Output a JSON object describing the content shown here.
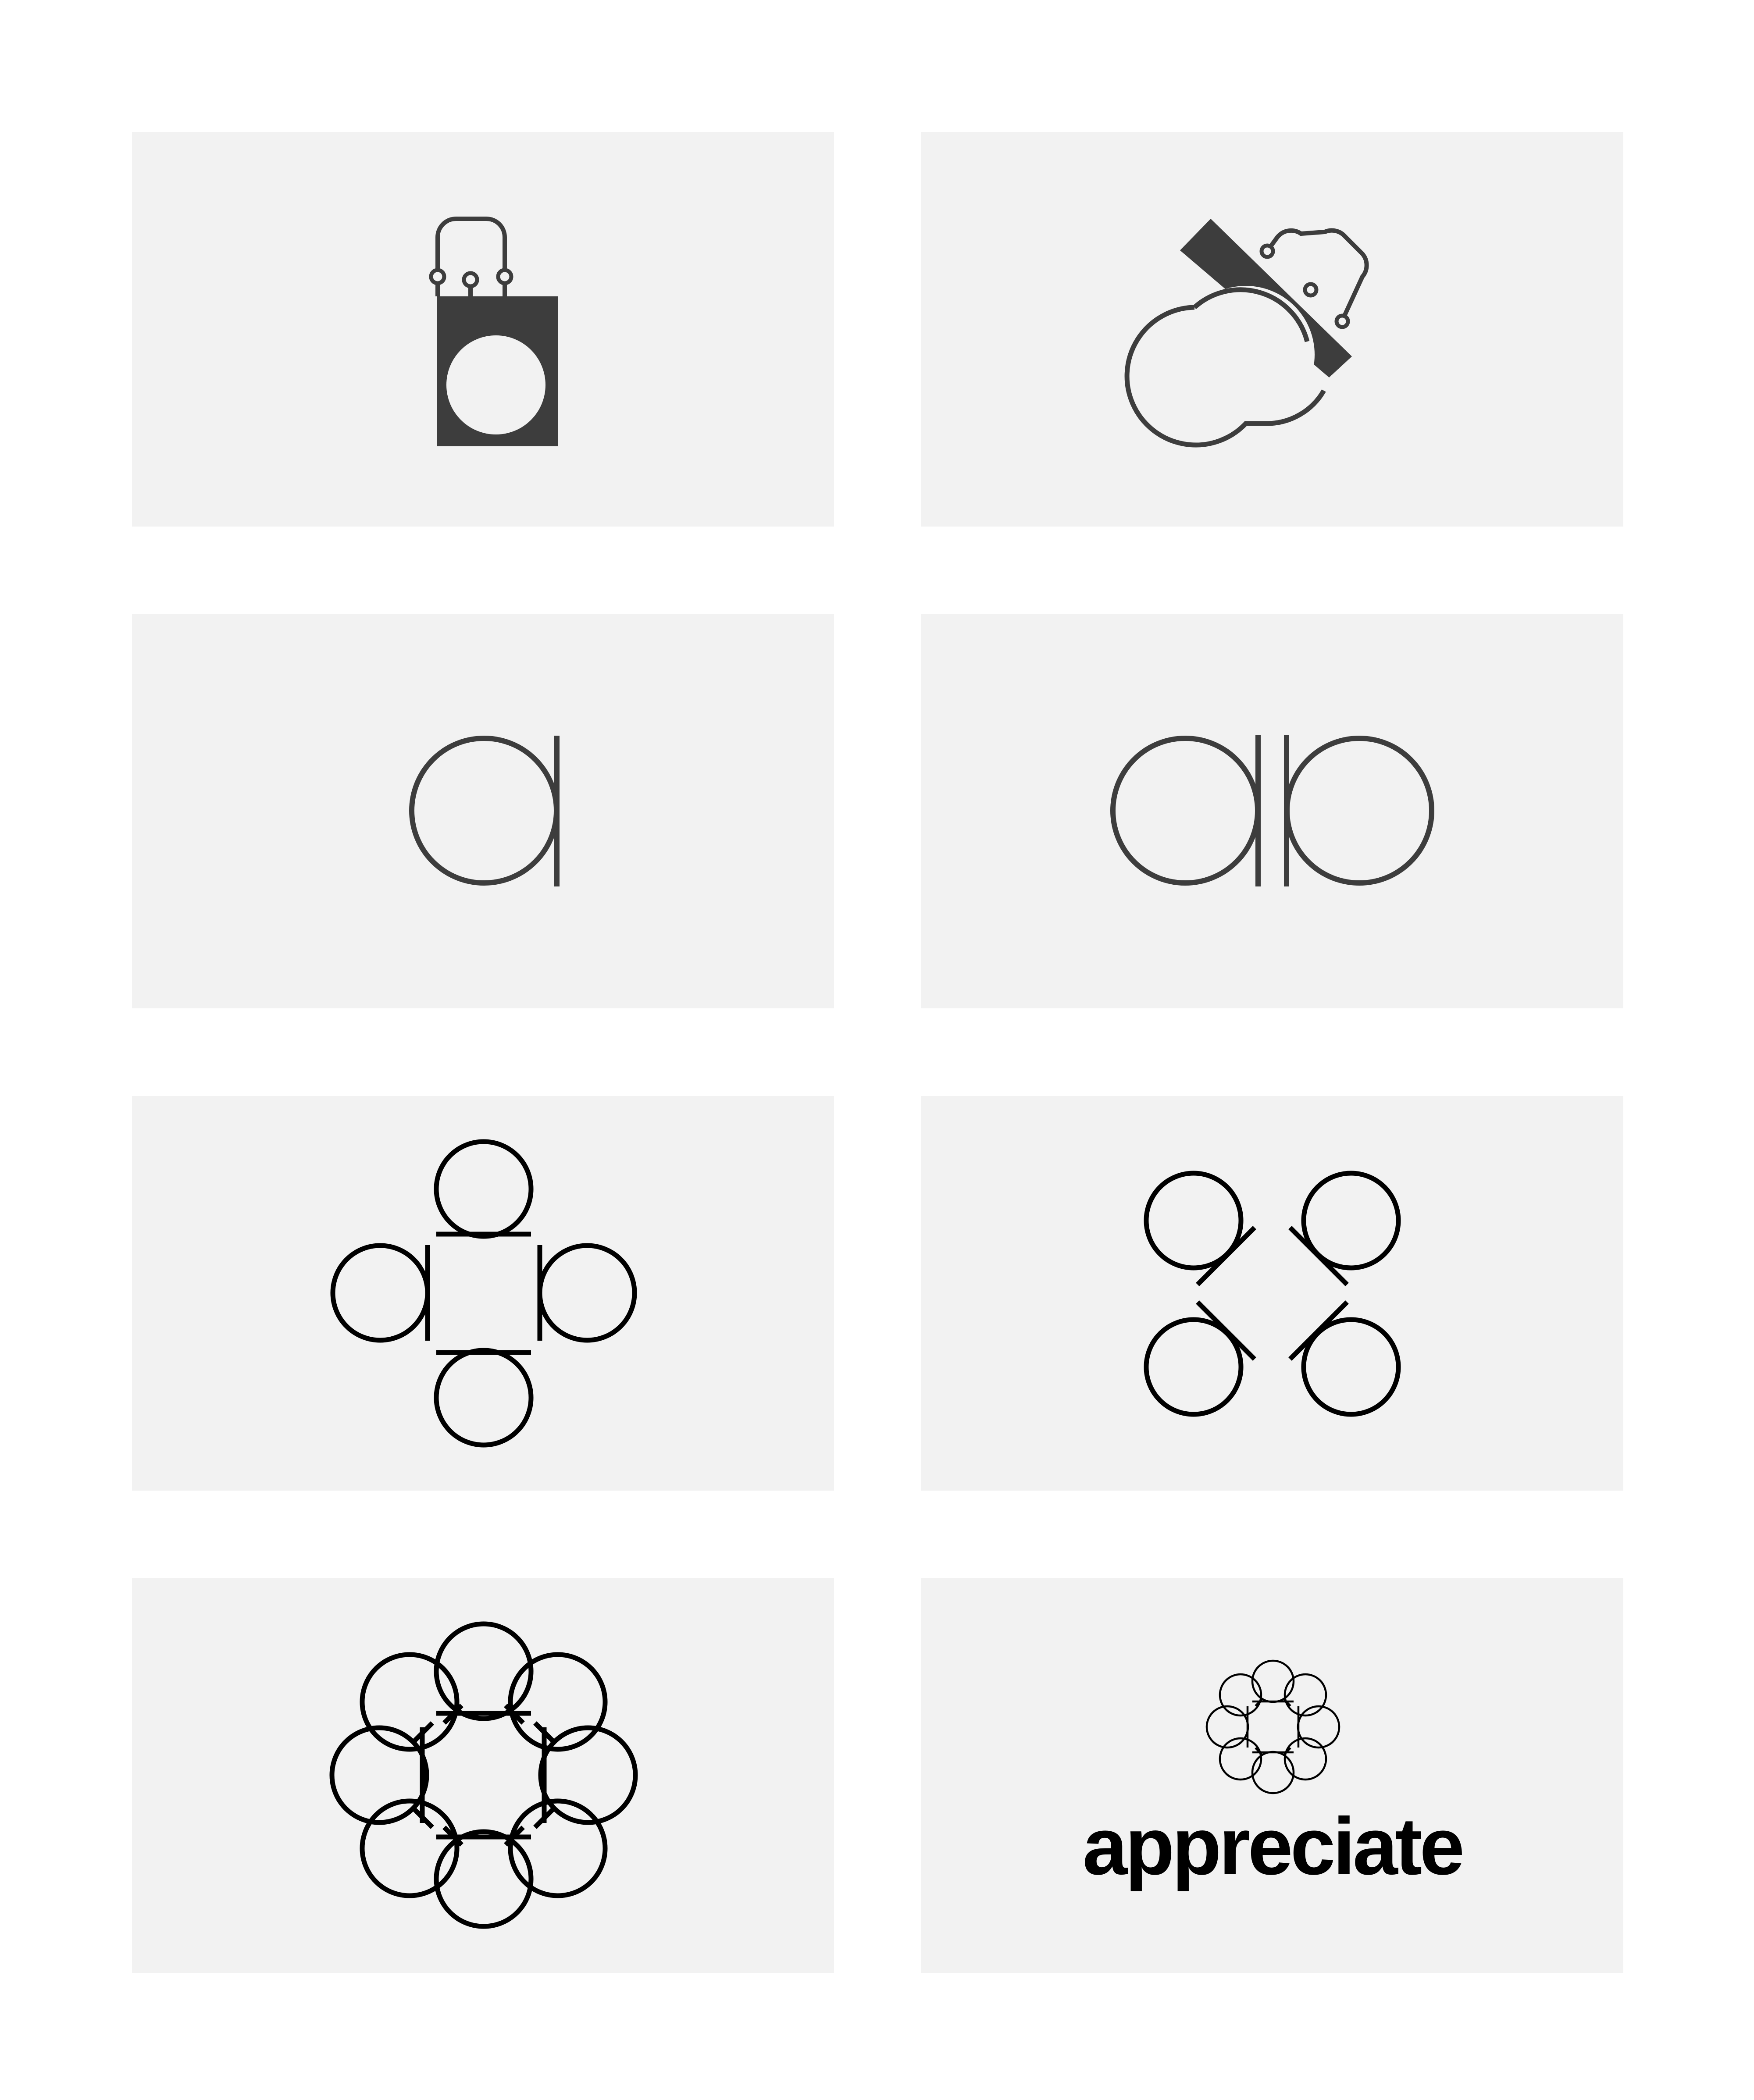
{
  "brand": {
    "wordmark": "appreciate",
    "wordmark_color": "#000000"
  },
  "colors": {
    "page_background": "#ffffff",
    "panel_background": "#f2f2f2",
    "early_mark_color": "#3d3d3d",
    "final_mark_color": "#000000"
  },
  "panels": [
    {
      "id": "shopping-bag-a",
      "icon": "shopping-bag-letter-a-icon"
    },
    {
      "id": "tilted-shopping-bag-a",
      "icon": "tilted-shopping-bag-icon"
    },
    {
      "id": "letter-a",
      "icon": "letter-a-icon"
    },
    {
      "id": "letters-ab",
      "icon": "mirrored-ab-icon"
    },
    {
      "id": "four-letter-cross",
      "icon": "four-letter-cross-icon"
    },
    {
      "id": "four-letter-diagonal",
      "icon": "four-letter-diagonal-icon"
    },
    {
      "id": "eight-letter-flower",
      "icon": "eight-letter-flower-icon"
    },
    {
      "id": "final-logo",
      "icon": "appreciate-flower-icon"
    }
  ]
}
